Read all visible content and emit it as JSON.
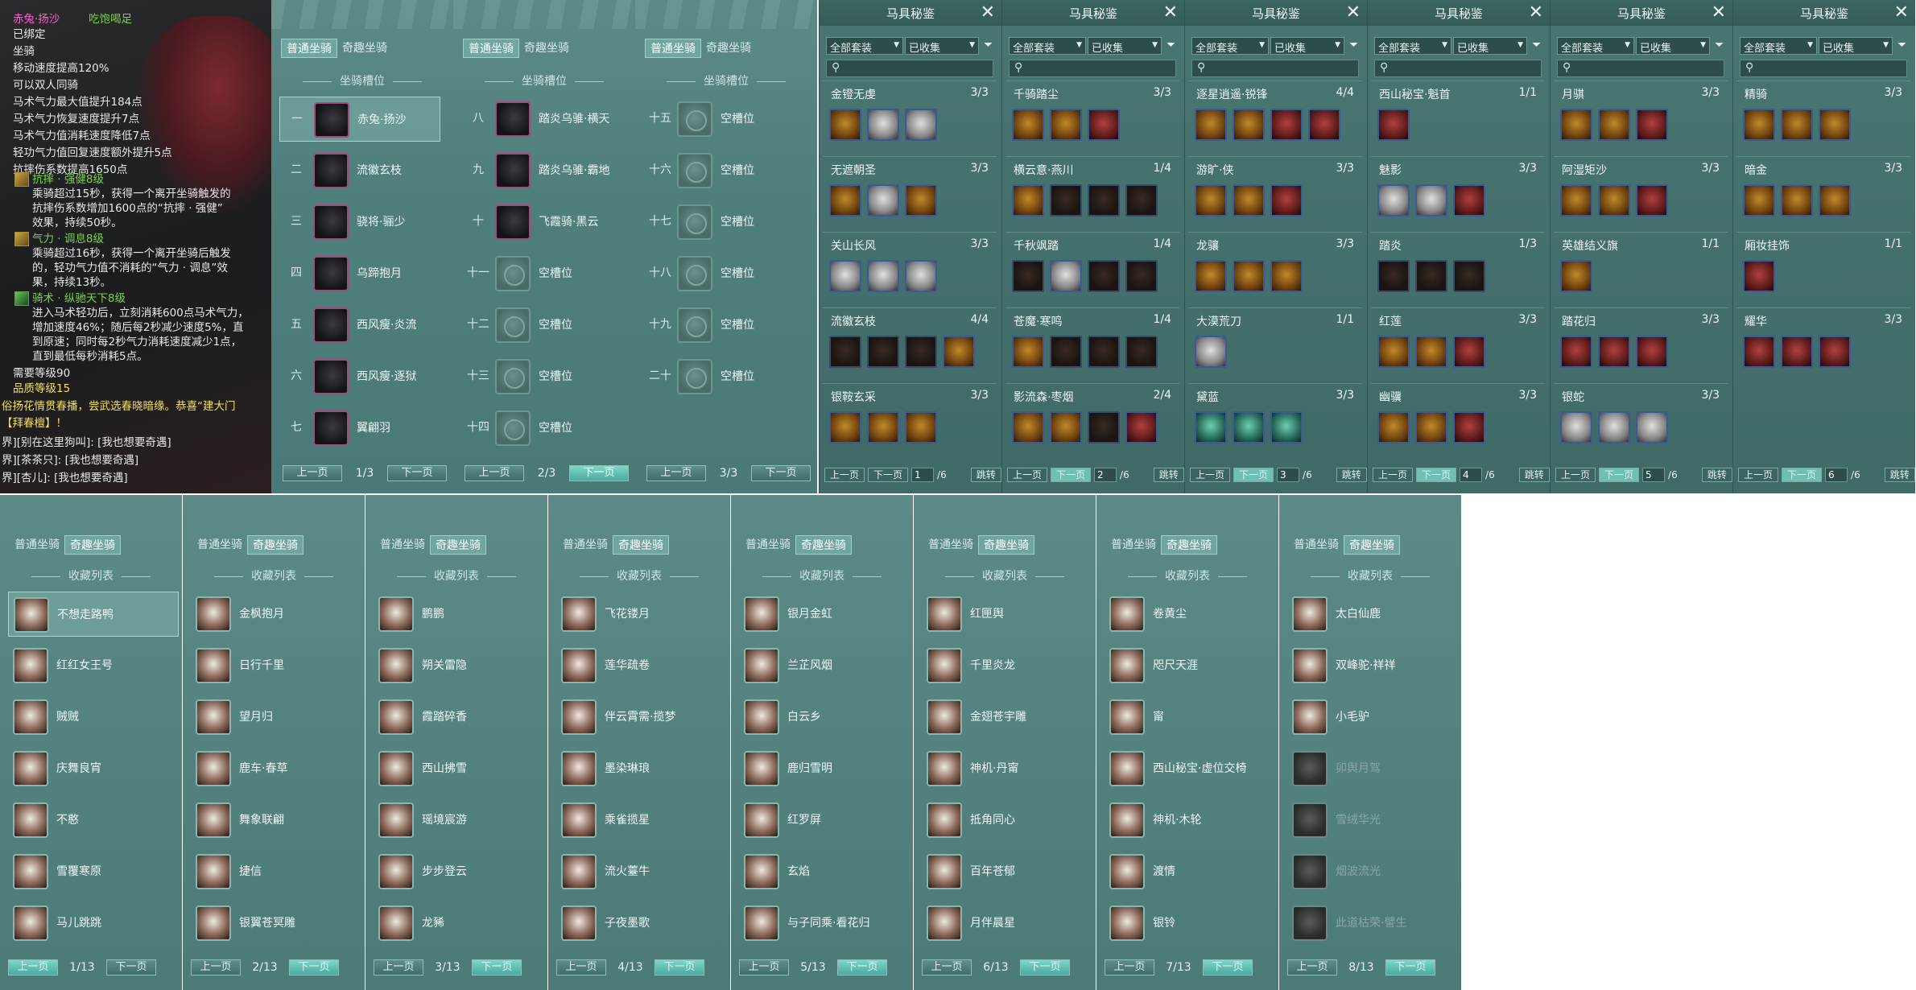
{
  "tooltip": {
    "title": "赤兔·扬沙",
    "status": "吃饱喝足",
    "lines": [
      "已绑定",
      "坐骑",
      "移动速度提高120%",
      "可以双人同骑",
      "马术气力最大值提升184点",
      "马术气力恢复速度提升7点",
      "马术气力值消耗速度降低7点",
      "轻功气力值回复速度额外提升5点",
      "抗摔伤系数提高1650点"
    ],
    "skill1_name": "抗摔 · 强健8级",
    "skill1_desc": [
      "乘骑超过15秒，获得一个离开坐骑触发的",
      "抗摔伤系数增加1600点的“抗摔 · 强健”",
      "效果，持续50秒。"
    ],
    "skill2_name": "气力 · 调息8级",
    "skill2_desc": [
      "乘骑超过16秒，获得一个离开坐骑后触发",
      "的，轻功气力值不消耗的“气力 · 调息”效",
      "果，持续13秒。"
    ],
    "skill3_name": "骑术 · 纵驰天下8级",
    "skill3_desc": [
      "进入马术轻功后，立刻消耗600点马术气力，",
      "增加速度46%；随后每2秒减少速度5%，直",
      "到原速；同时每2秒气力消耗速度减少1点，",
      "直到最低每秒消耗5点。"
    ],
    "req1": "需要等级90",
    "req2": "品质等级15",
    "chat": [
      "俗扬花情贯春播，尝武选春晓暗缘。恭喜“建大门",
      "【拜春檀】！",
      "界][别在这里狗叫]: [我也想要奇遇]",
      "界][茶茶只]: [我也想要奇遇]",
      "界][杏儿]: [我也想要奇遇]"
    ]
  },
  "tabs": {
    "normal": "普通坐骑",
    "fun": "奇趣坐骑"
  },
  "slot_section": "坐骑槽位",
  "collect_section": "收藏列表",
  "pager": {
    "prev": "上一页",
    "next": "下一页"
  },
  "slot_panels": [
    {
      "page": "1/3",
      "slots": [
        {
          "num": "一",
          "name": "赤兔·扬沙"
        },
        {
          "num": "二",
          "name": "流徽玄枝"
        },
        {
          "num": "三",
          "name": "骁将·骊少"
        },
        {
          "num": "四",
          "name": "乌蹄抱月"
        },
        {
          "num": "五",
          "name": "西风瘦·炎流"
        },
        {
          "num": "六",
          "name": "西风瘦·逐狱"
        },
        {
          "num": "七",
          "name": "翼翩羽"
        }
      ]
    },
    {
      "page": "2/3",
      "slots": [
        {
          "num": "八",
          "name": "踏炎乌骓·横天"
        },
        {
          "num": "九",
          "name": "踏炎乌骓·霸地"
        },
        {
          "num": "十",
          "name": "飞霞骑·黑云"
        },
        {
          "num": "十一",
          "name": "空槽位"
        },
        {
          "num": "十二",
          "name": "空槽位"
        },
        {
          "num": "十三",
          "name": "空槽位"
        },
        {
          "num": "十四",
          "name": "空槽位"
        }
      ]
    },
    {
      "page": "3/3",
      "slots": [
        {
          "num": "十五",
          "name": "空槽位"
        },
        {
          "num": "十六",
          "name": "空槽位"
        },
        {
          "num": "十七",
          "name": "空槽位"
        },
        {
          "num": "十八",
          "name": "空槽位"
        },
        {
          "num": "十九",
          "name": "空槽位"
        },
        {
          "num": "二十",
          "name": "空槽位"
        }
      ]
    }
  ],
  "book": {
    "title": "马具秘鉴",
    "close": "✕",
    "set_filter": "全部套装",
    "collect_filter": "已收集",
    "jump": "跳转",
    "total": "/6",
    "panels": [
      {
        "page": "1",
        "sets": [
          {
            "name": "金镫无虔",
            "count": "3/3"
          },
          {
            "name": "无遮朝圣",
            "count": "3/3"
          },
          {
            "name": "关山长风",
            "count": "3/3"
          },
          {
            "name": "流徽玄枝",
            "count": "4/4"
          },
          {
            "name": "银鞍玄采",
            "count": "3/3"
          }
        ]
      },
      {
        "page": "2",
        "sets": [
          {
            "name": "千骑踏尘",
            "count": "3/3"
          },
          {
            "name": "横云意·燕川",
            "count": "1/4"
          },
          {
            "name": "千秋飒踏",
            "count": "1/4"
          },
          {
            "name": "苍魔·寒鸣",
            "count": "1/4"
          },
          {
            "name": "影流森·枣烟",
            "count": "2/4"
          }
        ]
      },
      {
        "page": "3",
        "sets": [
          {
            "name": "逐星逍遥·锐锋",
            "count": "4/4"
          },
          {
            "name": "游旷·侠",
            "count": "3/3"
          },
          {
            "name": "龙骧",
            "count": "3/3"
          },
          {
            "name": "大漠荒刀",
            "count": "1/1"
          },
          {
            "name": "黛蓝",
            "count": "3/3"
          }
        ]
      },
      {
        "page": "4",
        "sets": [
          {
            "name": "西山秘宝·魁首",
            "count": "1/1"
          },
          {
            "name": "魅影",
            "count": "3/3"
          },
          {
            "name": "踏炎",
            "count": "1/3"
          },
          {
            "name": "红莲",
            "count": "3/3"
          },
          {
            "name": "幽骥",
            "count": "3/3"
          }
        ]
      },
      {
        "page": "5",
        "sets": [
          {
            "name": "月骐",
            "count": "3/3"
          },
          {
            "name": "阿湿矩沙",
            "count": "3/3"
          },
          {
            "name": "英雄结义旗",
            "count": "1/1"
          },
          {
            "name": "踏花归",
            "count": "3/3"
          },
          {
            "name": "银蛇",
            "count": "3/3"
          }
        ]
      },
      {
        "page": "6",
        "sets": [
          {
            "name": "精骑",
            "count": "3/3"
          },
          {
            "name": "暗金",
            "count": "3/3"
          },
          {
            "name": "厢妆挂饰",
            "count": "1/1"
          },
          {
            "name": "耀华",
            "count": "3/3"
          }
        ]
      }
    ]
  },
  "collect_panels": [
    {
      "page": "1/13",
      "items": [
        "不想走路鸭",
        "红红女王号",
        "贼贼",
        "庆舞良宵",
        "不憨",
        "雪覆寒原",
        "马儿跳跳"
      ]
    },
    {
      "page": "2/13",
      "items": [
        "金枫抱月",
        "日行千里",
        "望月归",
        "鹿车·春草",
        "舞象联翩",
        "捷信",
        "银翼苍冥雕"
      ]
    },
    {
      "page": "3/13",
      "items": [
        "鹏鹏",
        "朔关雷隐",
        "霞踏碎香",
        "西山拂雪",
        "瑶境宸游",
        "步步登云",
        "龙豨"
      ]
    },
    {
      "page": "4/13",
      "items": [
        "飞花镂月",
        "莲华疏卷",
        "伴云霄需·揽梦",
        "墨染琳琅",
        "乘雀揽星",
        "流火薹牛",
        "子夜墨歌"
      ]
    },
    {
      "page": "5/13",
      "items": [
        "银月金虹",
        "兰芷风烟",
        "白云乡",
        "鹿归雪明",
        "红罗屏",
        "玄焰",
        "与子同乘·看花归"
      ]
    },
    {
      "page": "6/13",
      "items": [
        "红匣舆",
        "千里炎龙",
        "金翅苍宇雕",
        "神机·丹甯",
        "抵角同心",
        "百年苍郁",
        "月伴晨星"
      ]
    },
    {
      "page": "7/13",
      "items": [
        "卷黄尘",
        "咫尺天涯",
        "甯",
        "西山秘宝·虚位交椅",
        "神机·木轮",
        "渡情",
        "银铃"
      ]
    },
    {
      "page": "8/13",
      "items": [
        "太白仙鹿",
        "双峰驼·祥祥",
        "小毛驴",
        "卯舆月驾",
        "雪绒华光",
        "烟波流光",
        "此道枯荣·譬生"
      ]
    }
  ]
}
